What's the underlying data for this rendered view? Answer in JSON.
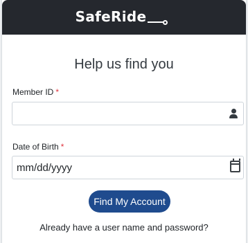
{
  "header": {
    "brand": "SafeRide"
  },
  "form": {
    "title": "Help us find you",
    "member_id": {
      "label": "Member ID",
      "required_mark": "*",
      "value": "",
      "icon": "person-icon"
    },
    "dob": {
      "label": "Date of Birth",
      "required_mark": "*",
      "value": "mm/dd/yyyy",
      "icon": "calendar-icon"
    },
    "submit_label": "Find My Account",
    "footer_text": "Already have a user name and password?"
  },
  "colors": {
    "header_bg": "#25282e",
    "button_bg": "#1f4b8e",
    "required": "#e0343e"
  }
}
